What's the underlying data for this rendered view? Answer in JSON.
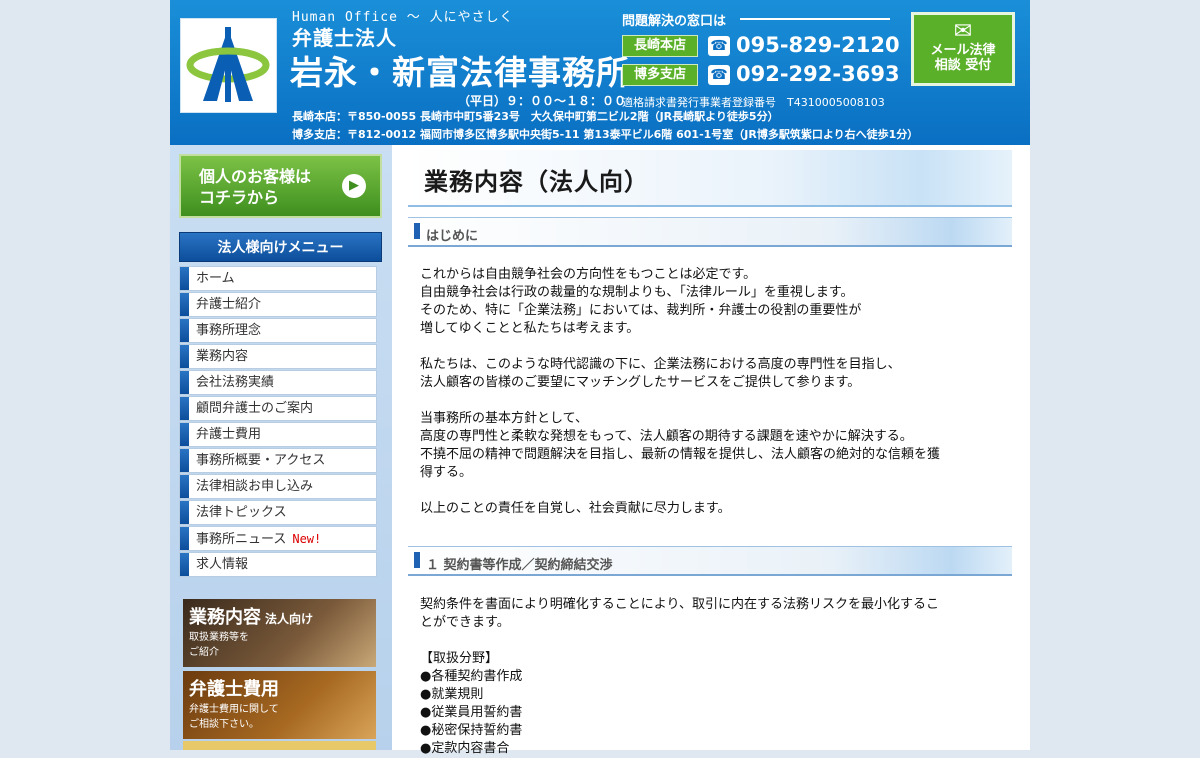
{
  "header": {
    "tagline": "Human Office 〜 人にやさしく",
    "firm_type": "弁護士法人",
    "firm_name": "岩永・新富法律事務所",
    "contact_title": "問題解決の窓口は",
    "offices": [
      {
        "badge": "長崎本店",
        "phone": "095-829-2120"
      },
      {
        "badge": "博多支店",
        "phone": "092-292-3693"
      }
    ],
    "hours": "（平日）９：００〜１８：００",
    "registration": "適格請求書発行事業者登録番号　T4310005008103",
    "address_nagasaki": "長崎本店：〒850-0055 長崎市中町5番23号　大久保中町第二ビル2階（JR長崎駅より徒歩5分）",
    "address_hakata": "博多支店：〒812-0012 福岡市博多区博多駅中央街5-11 第13泰平ビル6階 601-1号室（JR博多駅筑紫口より右へ徒歩1分）",
    "mail_button": {
      "line1": "メール法律",
      "line2": "相談 受付"
    },
    "phone_icon": "phone-icon",
    "mail_icon": "envelope-icon"
  },
  "sidebar": {
    "personal_button": {
      "line1": "個人のお客様は",
      "line2": "コチラから"
    },
    "menu_title": "法人様向けメニュー",
    "menu_items": [
      {
        "label": "ホーム"
      },
      {
        "label": "弁護士紹介"
      },
      {
        "label": "事務所理念"
      },
      {
        "label": "業務内容"
      },
      {
        "label": "会社法務実績"
      },
      {
        "label": "顧問弁護士のご案内"
      },
      {
        "label": "弁護士費用"
      },
      {
        "label": "事務所概要・アクセス"
      },
      {
        "label": "法律相談お申し込み"
      },
      {
        "label": "法律トピックス"
      },
      {
        "label": "事務所ニュース",
        "badge": "New!"
      },
      {
        "label": "求人情報"
      }
    ],
    "banners": [
      {
        "title": "業務内容",
        "sub": "法人向け",
        "desc1": "取扱業務等を",
        "desc2": "ご紹介"
      },
      {
        "title": "弁護士費用",
        "sub": "",
        "desc1": "弁護士費用に関して",
        "desc2": "ご相談下さい。"
      }
    ]
  },
  "main": {
    "page_title": "業務内容（法人向）",
    "sections": [
      {
        "title": "はじめに",
        "lines": [
          "これからは自由競争社会の方向性をもつことは必定です。",
          "自由競争社会は行政の裁量的な規制よりも、「法律ルール」を重視します。",
          "そのため、特に「企業法務」においては、裁判所・弁護士の役割の重要性が",
          "増してゆくことと私たちは考えます。",
          "",
          "私たちは、このような時代認識の下に、企業法務における高度の専門性を目指し、",
          "法人顧客の皆様のご要望にマッチングしたサービスをご提供して参ります。",
          "",
          "当事務所の基本方針として、",
          "高度の専門性と柔軟な発想をもって、法人顧客の期待する課題を速やかに解決する。",
          "不撓不屈の精神で問題解決を目指し、最新の情報を提供し、法人顧客の絶対的な信頼を獲",
          "得する。",
          "",
          "以上のことの責任を自覚し、社会貢献に尽力します。"
        ]
      },
      {
        "title": "１ 契約書等作成／契約締結交渉",
        "lines": [
          "契約条件を書面により明確化することにより、取引に内在する法務リスクを最小化するこ",
          "とができます。",
          "",
          "【取扱分野】",
          "●各種契約書作成",
          "●就業規則",
          "●従業員用誓約書",
          "●秘密保持誓約書",
          "●定款内容書合"
        ]
      }
    ]
  }
}
